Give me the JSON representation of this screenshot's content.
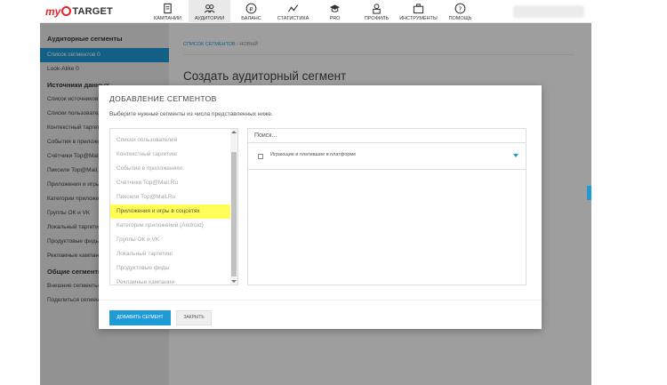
{
  "brand": {
    "my": "my",
    "target": "TARGET",
    "accent": "#e5242b"
  },
  "nav": [
    {
      "label": "КАМПАНИИ",
      "icon": "document-icon"
    },
    {
      "label": "АУДИТОРИИ",
      "icon": "users-icon"
    },
    {
      "label": "БАЛАНС",
      "icon": "ruble-icon"
    },
    {
      "label": "СТАТИСТИКА",
      "icon": "chart-line-icon"
    },
    {
      "label": "PRO",
      "icon": "graduation-cap-icon"
    },
    {
      "label": "ПРОФИЛЬ",
      "icon": "profile-icon"
    },
    {
      "label": "ИНСТРУМЕНТЫ",
      "icon": "tools-icon"
    },
    {
      "label": "ПОМОЩЬ",
      "icon": "help-icon"
    }
  ],
  "sidebar": {
    "sections": [
      {
        "title": "Аудиторные сегменты",
        "items": [
          "Список сегментов 0",
          "Look-Alike 0"
        ]
      },
      {
        "title": "Источники данных",
        "items": [
          "Список источников",
          "Списки пользователей",
          "Контекстный таргетинг",
          "События в приложениях",
          "Счётчики Top@Mail.Ru",
          "Пиксели Top@Mail.Ru",
          "Приложения и игры",
          "Категории приложений",
          "Группы ОК и VK",
          "Локальный таргетинг",
          "Продуктовые фиды",
          "Рекламные кампании"
        ]
      },
      {
        "title": "Общие сегменты",
        "items": [
          "Внешние сегменты",
          "Поделиться сегментами"
        ]
      }
    ]
  },
  "breadcrumb": {
    "link": "СПИСОК СЕГМЕНТОВ",
    "sep": " › ",
    "current": "НОВЫЙ"
  },
  "page_title": "Создать аудиторный сегмент",
  "modal": {
    "title": "ДОБАВЛЕНИЕ СЕГМЕНТОВ",
    "subtitle": "Выберите нужные сегменты из числа представленных ниже.",
    "list": [
      "Списки пользователей",
      "Контекстный таргетинг",
      "События в приложениях",
      "Счётчики Top@Mail.Ru",
      "Пиксели Top@Mail.Ru",
      "Приложения и игры в соцсетях",
      "Категории приложений (Android)",
      "Группы ОК и VK",
      "Локальный таргетинг",
      "Продуктовые фиды",
      "Рекламные кампании"
    ],
    "highlighted_index": 5,
    "search_placeholder": "Поиск...",
    "segment_label": "Играющие и платившие в платформе",
    "add_button": "ДОБАВИТЬ СЕГМЕНТ",
    "close_button": "ЗАКРЫТЬ"
  },
  "colors": {
    "primary": "#1e9bd7",
    "highlight": "#ffff55"
  }
}
